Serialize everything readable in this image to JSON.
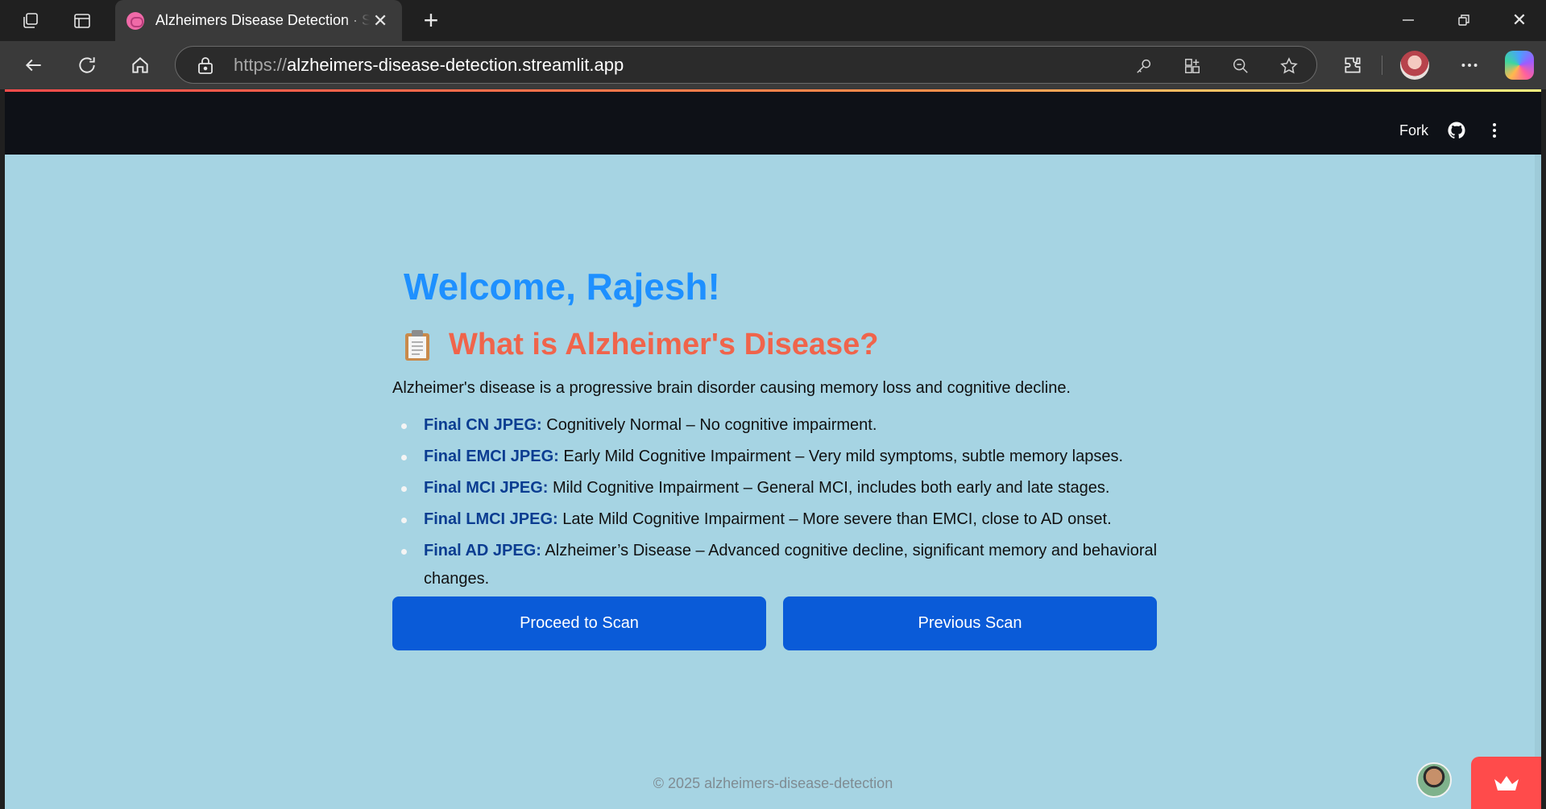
{
  "browser": {
    "tab_title": "Alzheimers Disease Detection · Streamlit",
    "url_protocol": "https://",
    "url_host": "alzheimers-disease-detection.streamlit.app"
  },
  "app_header": {
    "fork_label": "Fork"
  },
  "main": {
    "welcome": "Welcome, Rajesh!",
    "heading": "What is Alzheimer's Disease?",
    "intro": "Alzheimer's disease is a progressive brain disorder causing memory loss and cognitive decline.",
    "items": [
      {
        "label": "Final CN JPEG:",
        "text": " Cognitively Normal – No cognitive impairment."
      },
      {
        "label": "Final EMCI JPEG:",
        "text": " Early Mild Cognitive Impairment – Very mild symptoms, subtle memory lapses."
      },
      {
        "label": "Final MCI JPEG:",
        "text": " Mild Cognitive Impairment – General MCI, includes both early and late stages."
      },
      {
        "label": "Final LMCI JPEG:",
        "text": " Late Mild Cognitive Impairment – More severe than EMCI, close to AD onset."
      },
      {
        "label": "Final AD JPEG:",
        "text": " Alzheimer’s Disease – Advanced cognitive decline, significant memory and behavioral changes."
      }
    ],
    "buttons": {
      "proceed": "Proceed to Scan",
      "previous": "Previous Scan"
    }
  },
  "footer": {
    "copyright": "© 2025 alzheimers-disease-detection"
  },
  "colors": {
    "page_bg": "#a6d4e3",
    "welcome": "#1e90ff",
    "heading": "#f0644b",
    "item_label": "#0b3d91",
    "button": "#0a5bd8",
    "streamlit_badge": "#ff4b4b"
  },
  "icons": {
    "heading_icon": "clipboard-icon",
    "app_header": [
      "github-icon",
      "more-vertical-icon"
    ]
  }
}
